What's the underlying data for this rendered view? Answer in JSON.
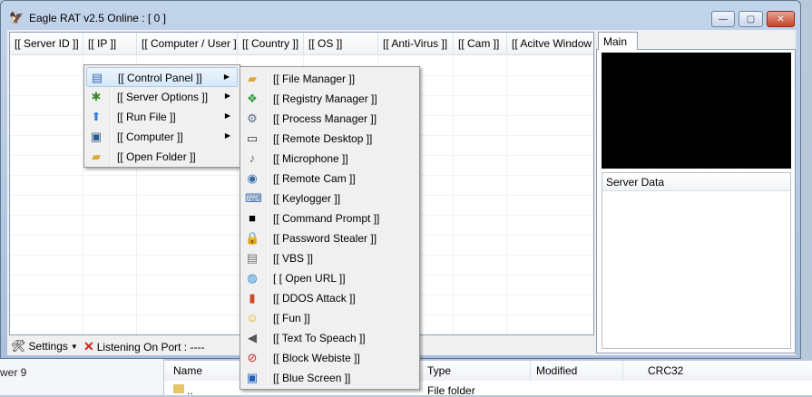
{
  "window": {
    "title": "Eagle RAT v2.5 Online : [ 0 ]",
    "buttons": {
      "minimize": "—",
      "maximize": "▢",
      "close": "✕"
    }
  },
  "columns": [
    "[[ Server ID ]]",
    "[[ IP ]]",
    "[[ Computer / User ]]",
    "[[ Country ]]",
    "[[ OS ]]",
    "[[ Anti-Virus ]]",
    "[[ Cam ]]",
    "[[ Acitve Window ]]"
  ],
  "status": {
    "settings": "Settings",
    "listening": "Listening On Port : ----"
  },
  "right_panel": {
    "tab": "Main",
    "server_data": "Server Data"
  },
  "context_menu": {
    "items": [
      {
        "label": "[[ Control Panel ]]",
        "icon": "control-panel-icon"
      },
      {
        "label": "[[ Server Options ]]",
        "icon": "bug-icon"
      },
      {
        "label": "[[ Run File ]]",
        "icon": "upload-arrow-icon"
      },
      {
        "label": "[[ Computer ]]",
        "icon": "computer-icon"
      },
      {
        "label": "[[ Open Folder ]]",
        "icon": "folder-icon"
      }
    ]
  },
  "submenu": {
    "items": [
      {
        "label": "[[ File Manager ]]",
        "icon": "folder-icon"
      },
      {
        "label": "[[ Registry Manager ]]",
        "icon": "registry-icon"
      },
      {
        "label": "[[ Process Manager ]]",
        "icon": "gears-icon"
      },
      {
        "label": "[[ Remote Desktop ]]",
        "icon": "monitor-icon"
      },
      {
        "label": "[[ Microphone ]]",
        "icon": "microphone-icon"
      },
      {
        "label": "[[ Remote Cam ]]",
        "icon": "webcam-icon"
      },
      {
        "label": "[[ Keylogger ]]",
        "icon": "keyboard-search-icon"
      },
      {
        "label": "[[ Command Prompt ]]",
        "icon": "console-icon"
      },
      {
        "label": "[[ Password Stealer ]]",
        "icon": "lock-icon"
      },
      {
        "label": "[[ VBS ]]",
        "icon": "script-icon"
      },
      {
        "label": "[ [ Open URL ]]",
        "icon": "globe-icon"
      },
      {
        "label": "[[ DDOS Attack ]]",
        "icon": "bar-chart-icon"
      },
      {
        "label": "[[ Fun ]]",
        "icon": "smiley-icon"
      },
      {
        "label": "[[ Text To Speach ]]",
        "icon": "speaker-icon"
      },
      {
        "label": "[[ Block Webiste ]]",
        "icon": "block-icon"
      },
      {
        "label": "[[ Blue Screen ]]",
        "icon": "blue-screen-icon"
      }
    ]
  },
  "background": {
    "left_text": "wer 9",
    "columns": [
      "Name",
      "Type",
      "Modified",
      "CRC32"
    ],
    "row_type": "File folder",
    "row_name": ".."
  }
}
